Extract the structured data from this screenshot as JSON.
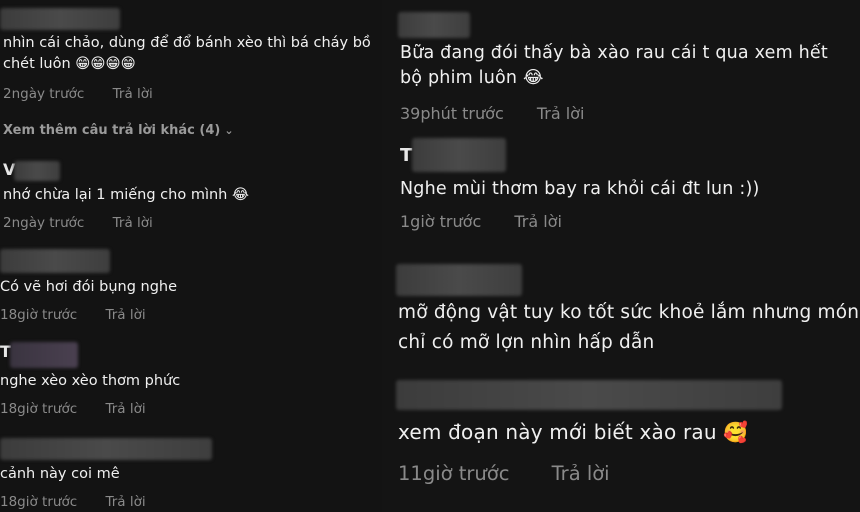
{
  "left": {
    "comments": [
      {
        "text": "nhìn cái chảo, dùng để đổ bánh xèo thì bá cháy bồ chét luôn 😁😁😁😁",
        "time": "2ngày trước",
        "reply": "Trả lời",
        "more_replies": "Xem thêm câu trả lời khác (4)"
      },
      {
        "initial": "V",
        "text": "nhớ chừa lại 1 miếng cho mình 😂",
        "time": "2ngày trước",
        "reply": "Trả lời"
      },
      {
        "text": "Có vẽ hơi đói bụng nghe",
        "time": "18giờ trước",
        "reply": "Trả lời"
      },
      {
        "initial": "T",
        "text": "nghe xèo xèo thơm phức",
        "time": "18giờ trước",
        "reply": "Trả lời"
      },
      {
        "text": "cảnh này coi mê",
        "time": "18giờ trước",
        "reply": "Trả lời"
      }
    ]
  },
  "right": {
    "comments": [
      {
        "text": "Bữa đang đói thấy bà xào rau cái t qua xem hết bộ phim luôn 😂",
        "time": "39phút trước",
        "reply": "Trả lời"
      },
      {
        "initial": "T",
        "text": "Nghe mùi thơm bay ra khỏi cái đt lun :))",
        "time": "1giờ trước",
        "reply": "Trả lời"
      },
      {
        "text": "mỡ động vật tuy ko tốt sức khoẻ lắm nhưng món chỉ có mỡ lợn nhìn hấp dẫn",
        "time": "",
        "reply": ""
      },
      {
        "text": "xem đoạn này mới biết xào rau 🥰",
        "time": "11giờ trước",
        "reply": "Trả lời"
      }
    ]
  }
}
